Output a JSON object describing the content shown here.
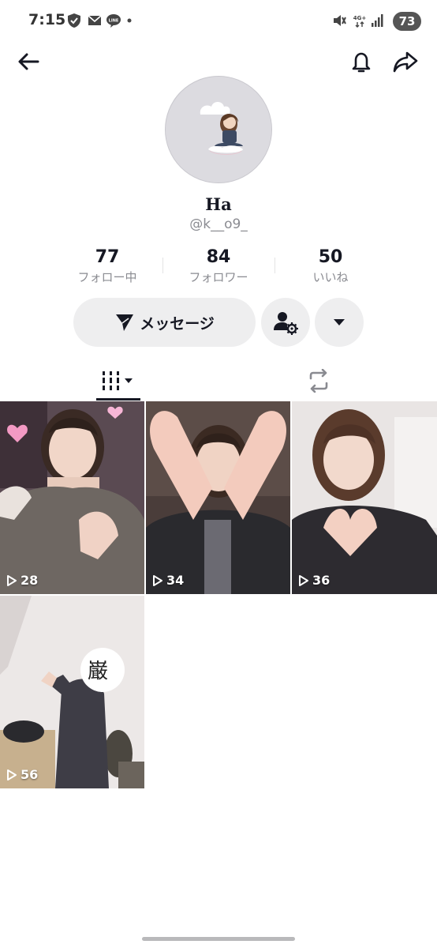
{
  "status_bar": {
    "time": "7:15",
    "battery": "73",
    "network": "4G+"
  },
  "nav": {
    "back_icon": "arrow-left-icon",
    "bell_icon": "bell-icon",
    "share_icon": "share-icon"
  },
  "profile": {
    "display_name": "Ha",
    "username": "@k__o9_",
    "stats": [
      {
        "value": "77",
        "label": "フォロー中"
      },
      {
        "value": "84",
        "label": "フォロワー"
      },
      {
        "value": "50",
        "label": "いいね"
      }
    ]
  },
  "actions": {
    "message_label": "メッセージ"
  },
  "videos": [
    {
      "views": "28"
    },
    {
      "views": "34"
    },
    {
      "views": "36"
    },
    {
      "views": "56"
    }
  ],
  "colors": {
    "text": "#161823",
    "secondary": "#8a8b91",
    "button_bg": "#eeeeef"
  }
}
